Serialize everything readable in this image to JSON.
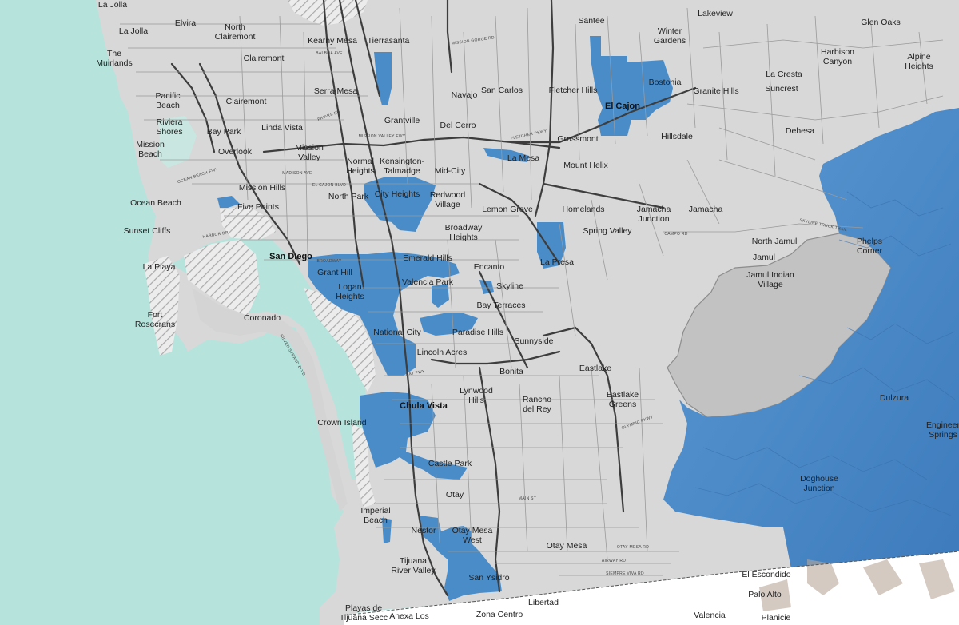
{
  "map": {
    "colors": {
      "water": "#b6e3dc",
      "land": "#d8d8d8",
      "highlight": "#4a8cc8",
      "excluded": "#c6c6c6"
    },
    "places": [
      {
        "id": "la-jolla-top",
        "name": "La Jolla",
        "bold": false
      },
      {
        "id": "la-jolla",
        "name": "La Jolla",
        "bold": false
      },
      {
        "id": "the-muirlands",
        "name": "The Muirlands",
        "bold": false
      },
      {
        "id": "pacific-beach",
        "name": "Pacific Beach",
        "bold": false
      },
      {
        "id": "riviera-shores",
        "name": "Riviera Shores",
        "bold": false
      },
      {
        "id": "mission-beach",
        "name": "Mission Beach",
        "bold": false
      },
      {
        "id": "ocean-beach",
        "name": "Ocean Beach",
        "bold": false
      },
      {
        "id": "sunset-cliffs",
        "name": "Sunset Cliffs",
        "bold": false
      },
      {
        "id": "la-playa",
        "name": "La Playa",
        "bold": false
      },
      {
        "id": "fort-rosecrans",
        "name": "Fort Rosecrans",
        "bold": false
      },
      {
        "id": "elvira",
        "name": "Elvira",
        "bold": false
      },
      {
        "id": "north-clairemont",
        "name": "North Clairemont",
        "bold": false
      },
      {
        "id": "clairemont-1",
        "name": "Clairemont",
        "bold": false
      },
      {
        "id": "clairemont-2",
        "name": "Clairemont",
        "bold": false
      },
      {
        "id": "kearny-mesa",
        "name": "Kearny Mesa",
        "bold": false
      },
      {
        "id": "tierrasanta",
        "name": "Tierrasanta",
        "bold": false
      },
      {
        "id": "serra-mesa",
        "name": "Serra Mesa",
        "bold": false
      },
      {
        "id": "bay-park",
        "name": "Bay Park",
        "bold": false
      },
      {
        "id": "linda-vista",
        "name": "Linda Vista",
        "bold": false
      },
      {
        "id": "overlook",
        "name": "Overlook",
        "bold": false
      },
      {
        "id": "mission-valley",
        "name": "Mission Valley",
        "bold": false
      },
      {
        "id": "mission-hills",
        "name": "Mission Hills",
        "bold": false
      },
      {
        "id": "five-points",
        "name": "Five Points",
        "bold": false
      },
      {
        "id": "normal-heights",
        "name": "Normal Heights",
        "bold": false
      },
      {
        "id": "kensington",
        "name": "Kensington-Talmadge",
        "bold": false
      },
      {
        "id": "grantville",
        "name": "Grantville",
        "bold": false
      },
      {
        "id": "del-cerro",
        "name": "Del Cerro",
        "bold": false
      },
      {
        "id": "navajo",
        "name": "Navajo",
        "bold": false
      },
      {
        "id": "san-carlos",
        "name": "San Carlos",
        "bold": false
      },
      {
        "id": "fletcher-hills",
        "name": "Fletcher Hills",
        "bold": false
      },
      {
        "id": "santee",
        "name": "Santee",
        "bold": false
      },
      {
        "id": "winter-gardens",
        "name": "Winter Gardens",
        "bold": false
      },
      {
        "id": "lakeview",
        "name": "Lakeview",
        "bold": false
      },
      {
        "id": "glen-oaks",
        "name": "Glen Oaks",
        "bold": false
      },
      {
        "id": "harbison-canyon",
        "name": "Harbison Canyon",
        "bold": false
      },
      {
        "id": "alpine-heights",
        "name": "Alpine Heights",
        "bold": false
      },
      {
        "id": "la-cresta",
        "name": "La Cresta",
        "bold": false
      },
      {
        "id": "suncrest",
        "name": "Suncrest",
        "bold": false
      },
      {
        "id": "bostonia",
        "name": "Bostonia",
        "bold": false
      },
      {
        "id": "el-cajon",
        "name": "El Cajon",
        "bold": true
      },
      {
        "id": "granite-hills",
        "name": "Granite Hills",
        "bold": false
      },
      {
        "id": "hillsdale",
        "name": "Hillsdale",
        "bold": false
      },
      {
        "id": "dehesa",
        "name": "Dehesa",
        "bold": false
      },
      {
        "id": "grossmont",
        "name": "Grossmont",
        "bold": false
      },
      {
        "id": "la-mesa",
        "name": "La Mesa",
        "bold": false
      },
      {
        "id": "mid-city",
        "name": "Mid-City",
        "bold": false
      },
      {
        "id": "mount-helix",
        "name": "Mount Helix",
        "bold": false
      },
      {
        "id": "north-park",
        "name": "North Park",
        "bold": false
      },
      {
        "id": "city-heights",
        "name": "City Heights",
        "bold": false
      },
      {
        "id": "redwood-village",
        "name": "Redwood Village",
        "bold": false
      },
      {
        "id": "lemon-grove",
        "name": "Lemon Grove",
        "bold": false
      },
      {
        "id": "homelands",
        "name": "Homelands",
        "bold": false
      },
      {
        "id": "jamacha-junction",
        "name": "Jamacha Junction",
        "bold": false
      },
      {
        "id": "jamacha",
        "name": "Jamacha",
        "bold": false
      },
      {
        "id": "spring-valley",
        "name": "Spring Valley",
        "bold": false
      },
      {
        "id": "broadway-heights",
        "name": "Broadway Heights",
        "bold": false
      },
      {
        "id": "north-jamul",
        "name": "North Jamul",
        "bold": false
      },
      {
        "id": "phelps-corner",
        "name": "Phelps Corner",
        "bold": false
      },
      {
        "id": "jamul",
        "name": "Jamul",
        "bold": false
      },
      {
        "id": "jamul-indian-village",
        "name": "Jamul Indian Village",
        "bold": false
      },
      {
        "id": "san-diego",
        "name": "San Diego",
        "bold": true
      },
      {
        "id": "grant-hill",
        "name": "Grant Hill",
        "bold": false
      },
      {
        "id": "logan-heights",
        "name": "Logan Heights",
        "bold": false
      },
      {
        "id": "emerald-hills",
        "name": "Emerald Hills",
        "bold": false
      },
      {
        "id": "encanto",
        "name": "Encanto",
        "bold": false
      },
      {
        "id": "la-presa",
        "name": "La Presa",
        "bold": false
      },
      {
        "id": "valencia-park",
        "name": "Valencia Park",
        "bold": false
      },
      {
        "id": "skyline",
        "name": "Skyline",
        "bold": false
      },
      {
        "id": "bay-terraces",
        "name": "Bay Terraces",
        "bold": false
      },
      {
        "id": "coronado",
        "name": "Coronado",
        "bold": false
      },
      {
        "id": "national-city",
        "name": "National City",
        "bold": false
      },
      {
        "id": "paradise-hills",
        "name": "Paradise Hills",
        "bold": false
      },
      {
        "id": "lincoln-acres",
        "name": "Lincoln Acres",
        "bold": false
      },
      {
        "id": "sunnyside",
        "name": "Sunnyside",
        "bold": false
      },
      {
        "id": "bonita",
        "name": "Bonita",
        "bold": false
      },
      {
        "id": "eastlake",
        "name": "Eastlake",
        "bold": false
      },
      {
        "id": "eastlake-greens",
        "name": "Eastlake Greens",
        "bold": false
      },
      {
        "id": "lynwood-hills",
        "name": "Lynwood Hills",
        "bold": false
      },
      {
        "id": "rancho-del-rey",
        "name": "Rancho del Rey",
        "bold": false
      },
      {
        "id": "chula-vista",
        "name": "Chula Vista",
        "bold": true
      },
      {
        "id": "crown-island",
        "name": "Crown Island",
        "bold": false
      },
      {
        "id": "castle-park",
        "name": "Castle Park",
        "bold": false
      },
      {
        "id": "otay",
        "name": "Otay",
        "bold": false
      },
      {
        "id": "dulzura",
        "name": "Dulzura",
        "bold": false
      },
      {
        "id": "engineer-springs",
        "name": "Engineer Springs",
        "bold": false
      },
      {
        "id": "doghouse-junction",
        "name": "Doghouse Junction",
        "bold": false
      },
      {
        "id": "imperial-beach",
        "name": "Imperial Beach",
        "bold": false
      },
      {
        "id": "nestor",
        "name": "Nestor",
        "bold": false
      },
      {
        "id": "otay-mesa-west",
        "name": "Otay Mesa West",
        "bold": false
      },
      {
        "id": "otay-mesa",
        "name": "Otay Mesa",
        "bold": false
      },
      {
        "id": "tijuana-river-valley",
        "name": "Tijuana River Valley",
        "bold": false
      },
      {
        "id": "san-ysidro",
        "name": "San Ysidro",
        "bold": false
      },
      {
        "id": "el-escondido",
        "name": "El Escondido",
        "bold": false
      },
      {
        "id": "palo-alto",
        "name": "Palo Alto",
        "bold": false
      },
      {
        "id": "libertad",
        "name": "Libertad",
        "bold": false
      },
      {
        "id": "playas-de-tijuana",
        "name": "Playas de Tijuana Secc",
        "bold": false
      },
      {
        "id": "anexa-los",
        "name": "Anexa Los",
        "bold": false
      },
      {
        "id": "zona-centro",
        "name": "Zona Centro",
        "bold": false
      },
      {
        "id": "valencia",
        "name": "Valencia",
        "bold": false
      },
      {
        "id": "planicie",
        "name": "Planicie",
        "bold": false
      }
    ],
    "roads": [
      {
        "id": "balboa-ave",
        "name": "BALBOA AVE"
      },
      {
        "id": "mission-gorge-rd",
        "name": "MISSION GORGE RD"
      },
      {
        "id": "friars-rd",
        "name": "FRIARS RD"
      },
      {
        "id": "mission-valley-fwy",
        "name": "MISSION VALLEY FWY"
      },
      {
        "id": "el-cajon-blvd",
        "name": "EL CAJON BLVD"
      },
      {
        "id": "madison-ave",
        "name": "MADISON AVE"
      },
      {
        "id": "broadway",
        "name": "BROADWAY"
      },
      {
        "id": "fletcher-pkwy",
        "name": "FLETCHER PKWY"
      },
      {
        "id": "campo-rd",
        "name": "CAMPO RD"
      },
      {
        "id": "skyline-truck-trail",
        "name": "SKYLINE TRUCK TRAIL"
      },
      {
        "id": "bay-fwy",
        "name": "BAY FWY"
      },
      {
        "id": "olympic-pkwy",
        "name": "OLYMPIC PKWY"
      },
      {
        "id": "otay-mesa-rd",
        "name": "OTAY MESA RD"
      },
      {
        "id": "airway-rd",
        "name": "AIRWAY RD"
      },
      {
        "id": "siempre-viva-rd",
        "name": "SIEMPRE VIVA RD"
      },
      {
        "id": "main-st",
        "name": "MAIN ST"
      },
      {
        "id": "silver-strand-blvd",
        "name": "SILVER STRAND BLVD"
      },
      {
        "id": "ocean-beach-fwy",
        "name": "OCEAN BEACH FWY"
      },
      {
        "id": "harbor-dr",
        "name": "HARBOR DR"
      }
    ]
  }
}
